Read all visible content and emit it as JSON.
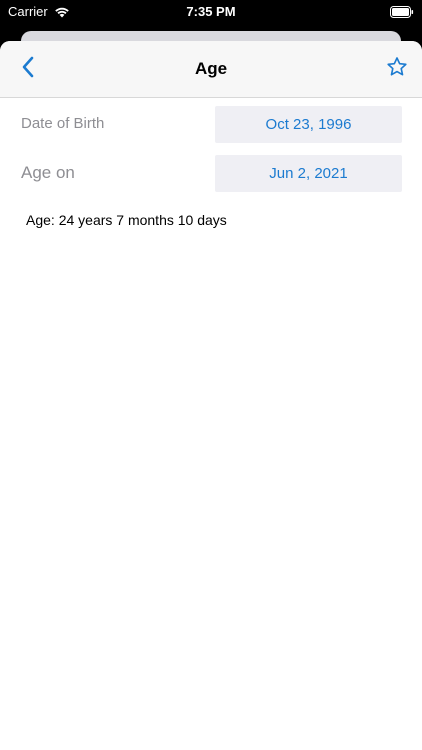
{
  "status_bar": {
    "carrier": "Carrier",
    "time": "7:35 PM",
    "wifi_icon": "wifi-icon",
    "battery_icon": "battery-icon"
  },
  "nav": {
    "title": "Age",
    "back_icon": "chevron-left-icon",
    "favorite_icon": "star-icon",
    "accent_color": "#1c7bd0"
  },
  "form": {
    "date_of_birth": {
      "label": "Date of Birth",
      "value": "Oct 23, 1996"
    },
    "age_on": {
      "label": "Age on",
      "value": "Jun 2, 2021"
    }
  },
  "result": {
    "text": "Age: 24 years 7 months 10 days"
  }
}
